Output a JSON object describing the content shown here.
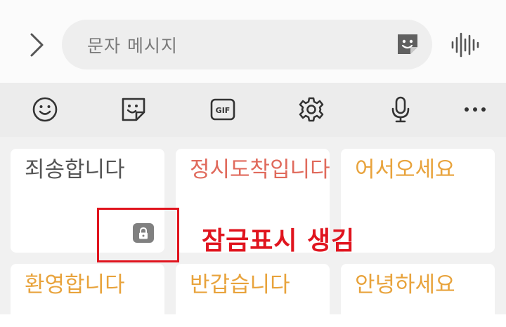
{
  "input": {
    "placeholder": "문자 메시지"
  },
  "toolbar": {
    "items": [
      "emoji-icon",
      "sticker-icon",
      "gif-icon",
      "gear-icon",
      "microphone-icon",
      "more-icon"
    ],
    "gif_label": "GIF"
  },
  "phrases": [
    {
      "text": "죄송합니다",
      "color": "#555555",
      "locked": true
    },
    {
      "text": "정시도착입니다",
      "color": "#e06a5c",
      "locked": false
    },
    {
      "text": "어서오세요",
      "color": "#e8a33c",
      "locked": false
    },
    {
      "text": "환영합니다",
      "color": "#e8a33c",
      "locked": false
    },
    {
      "text": "반갑습니다",
      "color": "#e8a33c",
      "locked": false
    },
    {
      "text": "안녕하세요",
      "color": "#e8a33c",
      "locked": false
    }
  ],
  "annotation": {
    "text": "잠금표시 생김",
    "color": "#e0141e"
  }
}
